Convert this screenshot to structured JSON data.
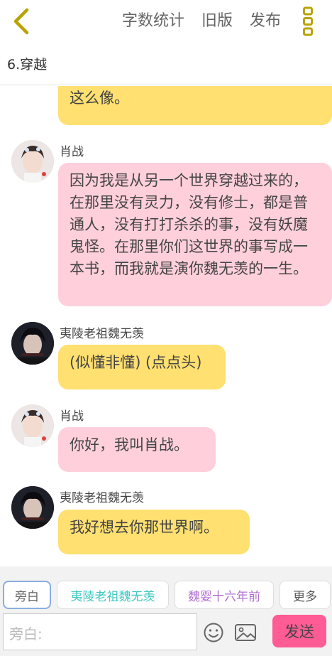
{
  "header": {
    "word_count_label": "字数统计",
    "old_version_label": "旧版",
    "publish_label": "发布"
  },
  "chapter": {
    "title": "6.穿越"
  },
  "messages": [
    {
      "text": "你怎么知道，话说为什么你和我长这么像。",
      "visible_text": "这么像。",
      "color": "yellow"
    },
    {
      "sender": "肖战",
      "text": "因为我是从另一个世界穿越过来的，在那里没有灵力，没有修士，都是普通人，没有打打杀杀的事，没有妖魔鬼怪。在那里你们这世界的事写成一本书，而我就是演你魏无羡的一生。",
      "color": "pink"
    },
    {
      "sender": "夷陵老祖魏无羡",
      "text": "(似懂非懂) (点点头)",
      "color": "yellow"
    },
    {
      "sender": "肖战",
      "text": "你好，我叫肖战。",
      "color": "pink"
    },
    {
      "sender": "夷陵老祖魏无羡",
      "text": "我好想去你那世界啊。",
      "color": "yellow"
    }
  ],
  "roles": {
    "narration": "旁白",
    "role1": "夷陵老祖魏无羡",
    "role2": "魏婴十六年前",
    "more": "更多"
  },
  "input": {
    "placeholder": "旁白:"
  },
  "send_label": "发送",
  "colors": {
    "yellow_bubble": "#ffe070",
    "pink_bubble": "#ffd0dc",
    "role1_text": "#3ec8c0",
    "role2_text": "#b070d0",
    "send_button": "#ff5c95",
    "accent_icon": "#b9a300"
  }
}
